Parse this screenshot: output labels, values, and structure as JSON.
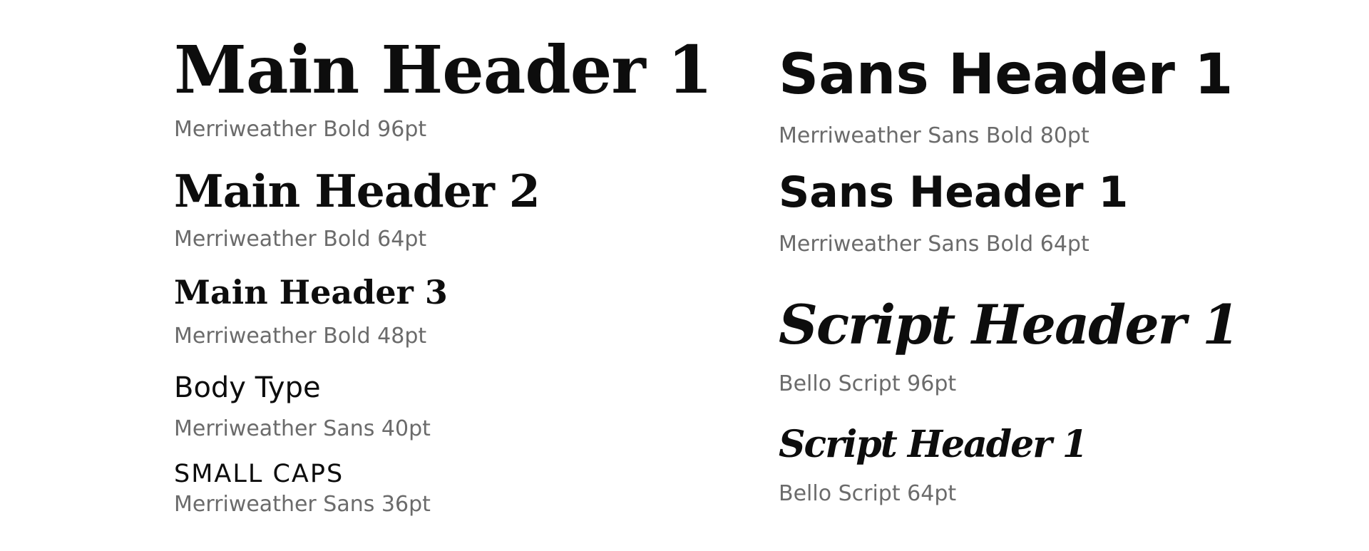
{
  "left_column": {
    "main_header_1": {
      "sample": "Main Header 1",
      "caption": "Merriweather Bold 96pt"
    },
    "main_header_2": {
      "sample": "Main Header 2",
      "caption": "Merriweather Bold 64pt"
    },
    "main_header_3": {
      "sample": "Main Header 3",
      "caption": "Merriweather Bold 48pt"
    },
    "body_type": {
      "sample": "Body Type",
      "caption": "Merriweather Sans 40pt"
    },
    "small_caps": {
      "sample": "SMALL CAPS",
      "caption": "Merriweather Sans 36pt"
    }
  },
  "right_column": {
    "sans_header_1_large": {
      "sample": "Sans Header 1",
      "caption": "Merriweather Sans Bold 80pt"
    },
    "sans_header_1_small": {
      "sample": "Sans Header 1",
      "caption": "Merriweather Sans Bold 64pt"
    },
    "script_header_1_large": {
      "sample": "Script Header 1",
      "caption": "Bello Script 96pt"
    },
    "script_header_1_small": {
      "sample": "Script Header 1",
      "caption": "Bello Script 64pt"
    }
  },
  "colors": {
    "sample_text": "#0d0d0d",
    "caption_text": "#6b6b6b",
    "background": "#ffffff"
  }
}
